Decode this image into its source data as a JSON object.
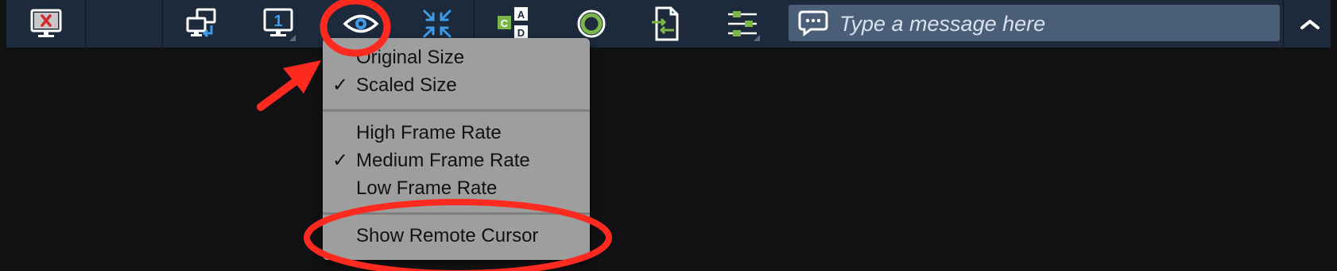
{
  "toolbar": {
    "buttons": [
      {
        "name": "disconnect-button",
        "icon": "monitor-x-icon"
      },
      {
        "name": "switch-role-button",
        "icon": "switch-monitors-icon"
      },
      {
        "name": "select-monitor-button",
        "icon": "monitor-1-icon",
        "monitor_number": "1"
      },
      {
        "name": "view-options-button",
        "icon": "eye-icon"
      },
      {
        "name": "minimize-view-button",
        "icon": "arrows-inward-icon"
      },
      {
        "name": "keyboard-shortcuts-button",
        "icon": "cad-keys-icon",
        "keys": [
          "C",
          "A",
          "D"
        ]
      },
      {
        "name": "record-button",
        "icon": "record-circle-icon"
      },
      {
        "name": "file-transfer-button",
        "icon": "file-transfer-icon"
      },
      {
        "name": "settings-button",
        "icon": "sliders-icon"
      }
    ],
    "chat": {
      "placeholder": "Type a message here",
      "icon": "chat-bubble-icon"
    },
    "collapse": {
      "icon": "chevron-up-icon"
    }
  },
  "view_menu": {
    "items": [
      {
        "label": "Original Size",
        "checked": false
      },
      {
        "label": "Scaled Size",
        "checked": true
      },
      {
        "label": "High Frame Rate",
        "checked": false
      },
      {
        "label": "Medium Frame Rate",
        "checked": true
      },
      {
        "label": "Low Frame Rate",
        "checked": false
      },
      {
        "label": "Show Remote Cursor",
        "checked": false
      }
    ],
    "check_mark": "✓"
  },
  "annotations": {
    "color": "#ff2a1f"
  },
  "colors": {
    "toolbar_bg": "#1c2a3c",
    "accent_blue": "#3f9be8",
    "accent_green": "#7ab648",
    "menu_bg": "#9e9e9e"
  }
}
